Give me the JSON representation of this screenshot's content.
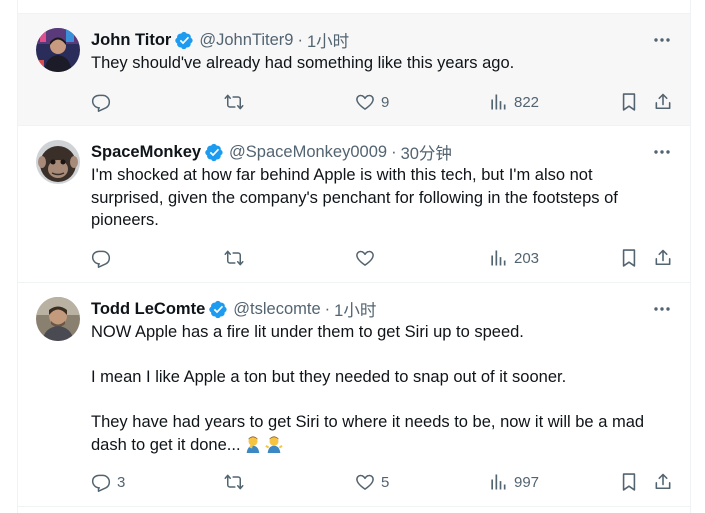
{
  "tweets": [
    {
      "name": "John Titor",
      "handle": "@JohnTiter9",
      "time": "1小时",
      "lines": [
        "They should've already had something like this years ago."
      ],
      "replies": "",
      "likes": "9",
      "views": "822"
    },
    {
      "name": "SpaceMonkey",
      "handle": "@SpaceMonkey0009",
      "time": "30分钟",
      "lines": [
        "I'm shocked at how far behind Apple is with this tech, but I'm also not",
        "surprised, given the company's penchant for following in the footsteps of",
        "pioneers."
      ],
      "replies": "",
      "likes": "",
      "views": "203"
    },
    {
      "name": "Todd LeComte",
      "handle": "@tslecomte",
      "time": "1小时",
      "lines": [
        "NOW Apple has a fire lit under them to get Siri up to speed.",
        "",
        "I mean I like Apple a ton but they needed to snap out of it sooner.",
        "",
        "They have had years to get Siri to where it needs to be, now it will be a mad",
        "dash to get it done..."
      ],
      "emojis": [
        "man-facepalming-emoji",
        "man-shrugging-emoji"
      ],
      "replies": "3",
      "likes": "5",
      "views": "997"
    }
  ],
  "separator": "·",
  "colors": {
    "text": "#0f1419",
    "muted": "#536471",
    "verified": "#1d9bf0",
    "divider": "#eff3f4",
    "hover_bg": "#f7f7f7"
  },
  "icons": [
    "more-icon",
    "verified-badge-icon",
    "reply-icon",
    "retweet-icon",
    "like-icon",
    "views-icon",
    "bookmark-icon",
    "share-icon"
  ]
}
